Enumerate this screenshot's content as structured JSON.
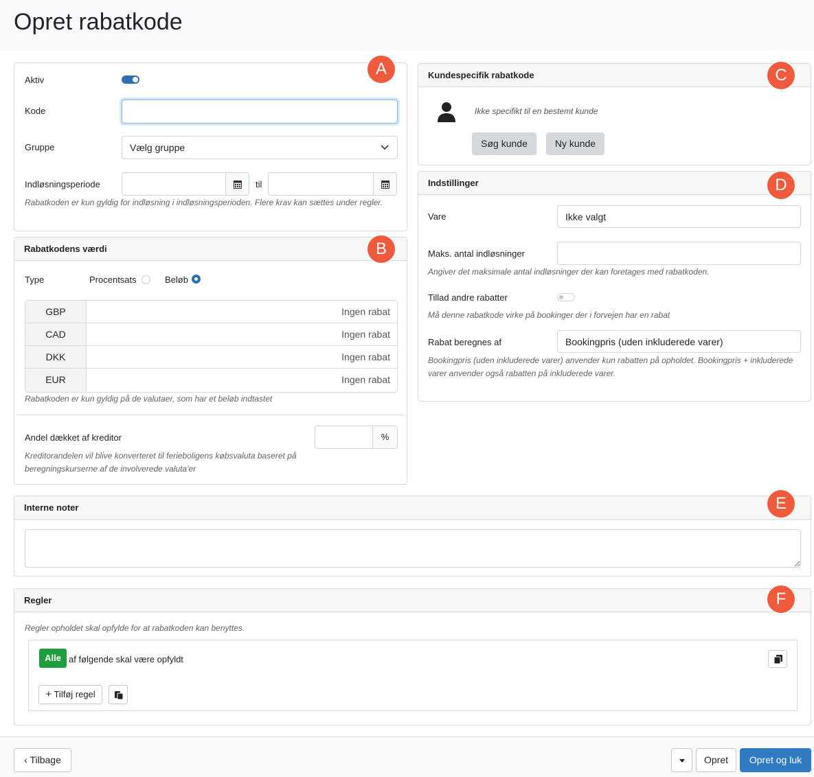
{
  "page": {
    "title": "Opret rabatkode"
  },
  "markers": [
    "A",
    "B",
    "C",
    "D",
    "E",
    "F"
  ],
  "general": {
    "active_label": "Aktiv",
    "active_on": true,
    "code_label": "Kode",
    "code_value": "",
    "group_label": "Gruppe",
    "group_value": "Vælg gruppe",
    "period_label": "Indløsningsperiode",
    "period_sep": "til",
    "period_help": "Rabatkoden er kun gyldig for indløsning i indløsningsperioden. Flere krav kan sættes under regler."
  },
  "value": {
    "title": "Rabatkodens værdi",
    "type_label": "Type",
    "type_options": [
      "Procentsats",
      "Beløb"
    ],
    "type_selected": "Beløb",
    "currencies": [
      {
        "code": "GBP",
        "value": "Ingen rabat"
      },
      {
        "code": "CAD",
        "value": "Ingen rabat"
      },
      {
        "code": "DKK",
        "value": "Ingen rabat"
      },
      {
        "code": "EUR",
        "value": "Ingen rabat"
      }
    ],
    "currency_help": "Rabatkoden er kun gyldig på de valutaer, som har et beløb indtastet",
    "creditor_label": "Andel dækket af kreditor",
    "creditor_unit": "%",
    "creditor_help": "Kreditorandelen vil blive konverteret til ferieboligens købsvaluta baseret på beregningskurserne af de involverede valuta'er"
  },
  "customer": {
    "title": "Kundespecifik rabatkode",
    "status": "Ikke specifikt til en bestemt kunde",
    "search_btn": "Søg kunde",
    "new_btn": "Ny kunde"
  },
  "settings": {
    "title": "Indstillinger",
    "item_label": "Vare",
    "item_value": "Ikke valgt",
    "max_label": "Maks. antal indløsninger",
    "max_help": "Angiver det maksimale antal indløsninger der kan foretages med rabatkoden.",
    "allow_label": "Tillad andre rabatter",
    "allow_on": false,
    "allow_help": "Må denne rabatkode virke på bookinger der i forvejen har en rabat",
    "calc_label": "Rabat beregnes af",
    "calc_value": "Bookingpris (uden inkluderede varer)",
    "calc_help": "Bookingpris (uden inkluderede varer) anvender kun rabatten på opholdet. Bookingpris + inkluderede varer anvender også rabatten på inkluderede varer."
  },
  "notes": {
    "title": "Interne noter",
    "value": ""
  },
  "rules": {
    "title": "Regler",
    "help": "Regler opholdet skal opfylde for at rabatkoden kan benyttes.",
    "mode": "Alle",
    "mode_text": "af følgende skal være opfyldt",
    "add_rule": "Tilføj regel"
  },
  "footer": {
    "back": "Tilbage",
    "create": "Opret",
    "create_close": "Opret og luk"
  },
  "colors": {
    "accent": "#2f7ac0",
    "marker": "#f05a3c",
    "success": "#1e9e3e"
  }
}
